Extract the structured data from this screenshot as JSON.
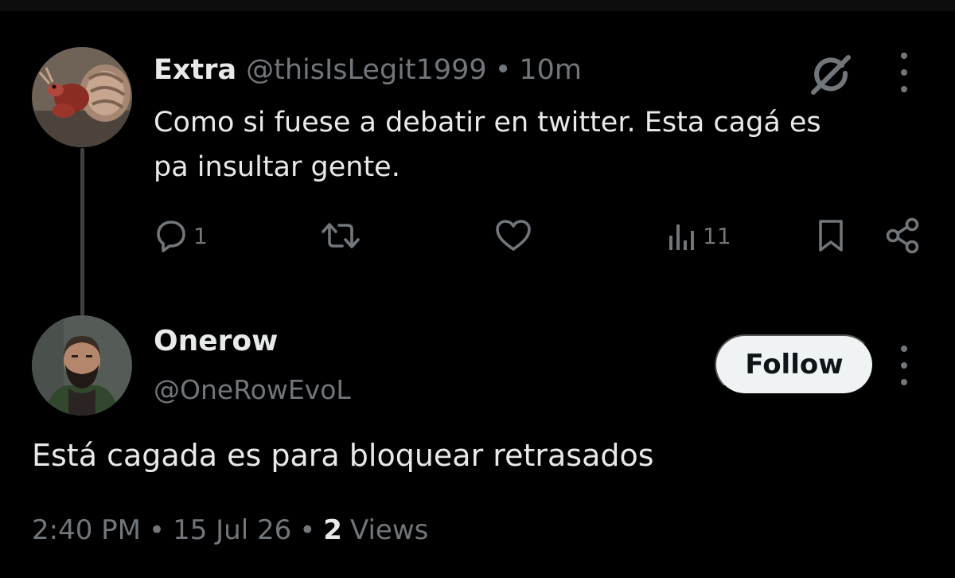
{
  "colors": {
    "background": "#000000",
    "primary_text": "#e7e9ea",
    "secondary_text": "#71767b",
    "follow_button_bg": "#eff3f4",
    "follow_button_text": "#0f1419"
  },
  "parent_tweet": {
    "display_name": "Extra",
    "handle": "@thisIsLegit1999",
    "separator": "•",
    "time_ago": "10m",
    "text_lines": [
      "Como si fuese a debatir en twitter. Esta cagá es",
      "pa insultar gente."
    ],
    "avatar_icon": "hermit-crab-avatar",
    "header_icons": [
      "grok-icon",
      "more-icon"
    ],
    "actions": {
      "reply": {
        "icon": "reply-icon",
        "count": "1"
      },
      "retweet": {
        "icon": "retweet-icon",
        "count": ""
      },
      "like": {
        "icon": "heart-icon",
        "count": ""
      },
      "views": {
        "icon": "analytics-icon",
        "count": "11"
      },
      "bookmark": {
        "icon": "bookmark-icon"
      },
      "share": {
        "icon": "share-icon"
      }
    }
  },
  "reply_tweet": {
    "display_name": "Onerow",
    "handle": "@OneRowEvoL",
    "follow_label": "Follow",
    "avatar_icon": "bearded-man-avatar",
    "text": "Está cagada es para bloquear retrasados",
    "meta": {
      "time": "2:40 PM",
      "separator": "•",
      "date": "15 Jul 26",
      "views_count": "2",
      "views_label": "Views"
    }
  }
}
